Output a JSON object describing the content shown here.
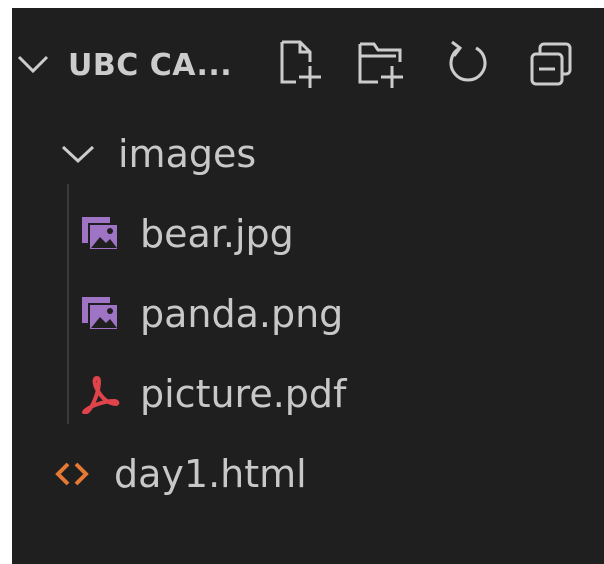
{
  "explorer": {
    "title": "UBC CA...",
    "actions": [
      {
        "name": "new-file",
        "icon": "new-file-icon"
      },
      {
        "name": "new-folder",
        "icon": "new-folder-icon"
      },
      {
        "name": "refresh",
        "icon": "refresh-icon"
      },
      {
        "name": "collapse-all",
        "icon": "collapse-all-icon"
      }
    ],
    "tree": [
      {
        "type": "folder",
        "label": "images",
        "expanded": true,
        "icon": "chevron-down-icon"
      },
      {
        "type": "file",
        "label": "bear.jpg",
        "icon": "image-file-icon",
        "depth": 1
      },
      {
        "type": "file",
        "label": "panda.png",
        "icon": "image-file-icon",
        "depth": 1
      },
      {
        "type": "file",
        "label": "picture.pdf",
        "icon": "pdf-file-icon",
        "depth": 1
      },
      {
        "type": "file",
        "label": "day1.html",
        "icon": "html-file-icon",
        "depth": 0
      }
    ]
  },
  "colors": {
    "background": "#1f1f1f",
    "text": "#cccccc",
    "image_icon": "#a074c4",
    "pdf_icon": "#e0444a",
    "html_icon": "#e37933",
    "indent_guide": "#3a3a3a"
  }
}
